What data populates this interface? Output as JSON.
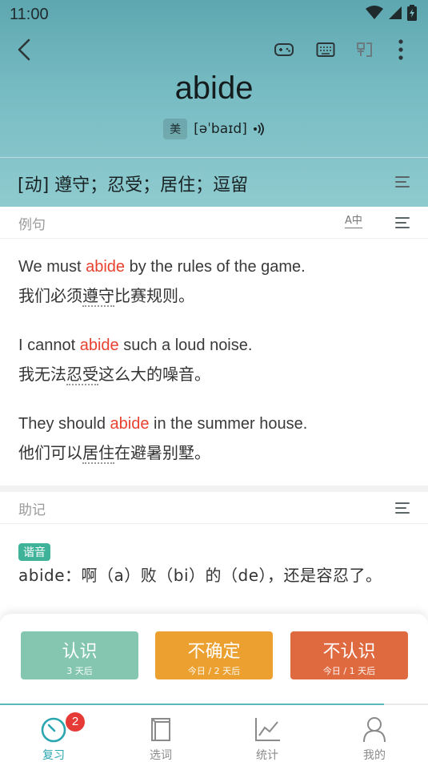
{
  "status": {
    "time": "11:00"
  },
  "word": {
    "headword": "abide",
    "region": "美",
    "phonetic": "[əˈbaɪd]",
    "definition": "[动] 遵守；忍受；居住；逗留"
  },
  "examples": {
    "title": "例句",
    "translate_icon_label": "A中",
    "items": [
      {
        "en_before": "We must ",
        "en_hl": "abide",
        "en_after": " by the rules of the game.",
        "zh_before": "我们必须",
        "zh_dot": "遵守",
        "zh_after": "比赛规则。"
      },
      {
        "en_before": "I cannot ",
        "en_hl": "abide",
        "en_after": " such a loud noise.",
        "zh_before": "我无法",
        "zh_dot": "忍受",
        "zh_after": "这么大的噪音。"
      },
      {
        "en_before": "They should ",
        "en_hl": "abide",
        "en_after": " in the summer house.",
        "zh_before": "他们可以",
        "zh_dot": "居住",
        "zh_after": "在避暑别墅。"
      }
    ]
  },
  "mnemonic": {
    "title": "助记",
    "tag": "谐音",
    "text": "abide：啊（a）败（bi）的（de），还是容忍了。"
  },
  "answers": {
    "know": {
      "label": "认识",
      "sub": "3 天后",
      "color": "#84c6b0"
    },
    "unsure": {
      "label": "不确定",
      "sub": "今日 / 2 天后",
      "color": "#eba02f"
    },
    "unknown": {
      "label": "不认识",
      "sub": "今日 / 1 天后",
      "color": "#e06a40"
    }
  },
  "tabs": [
    {
      "label": "复习",
      "badge": "2",
      "icon": "review-icon"
    },
    {
      "label": "选词",
      "icon": "wordbook-icon"
    },
    {
      "label": "统计",
      "icon": "chart-icon"
    },
    {
      "label": "我的",
      "icon": "profile-icon"
    }
  ],
  "colors": {
    "accent": "#2aa6b0",
    "highlight": "#e8412f",
    "tag": "#3fb39a"
  }
}
